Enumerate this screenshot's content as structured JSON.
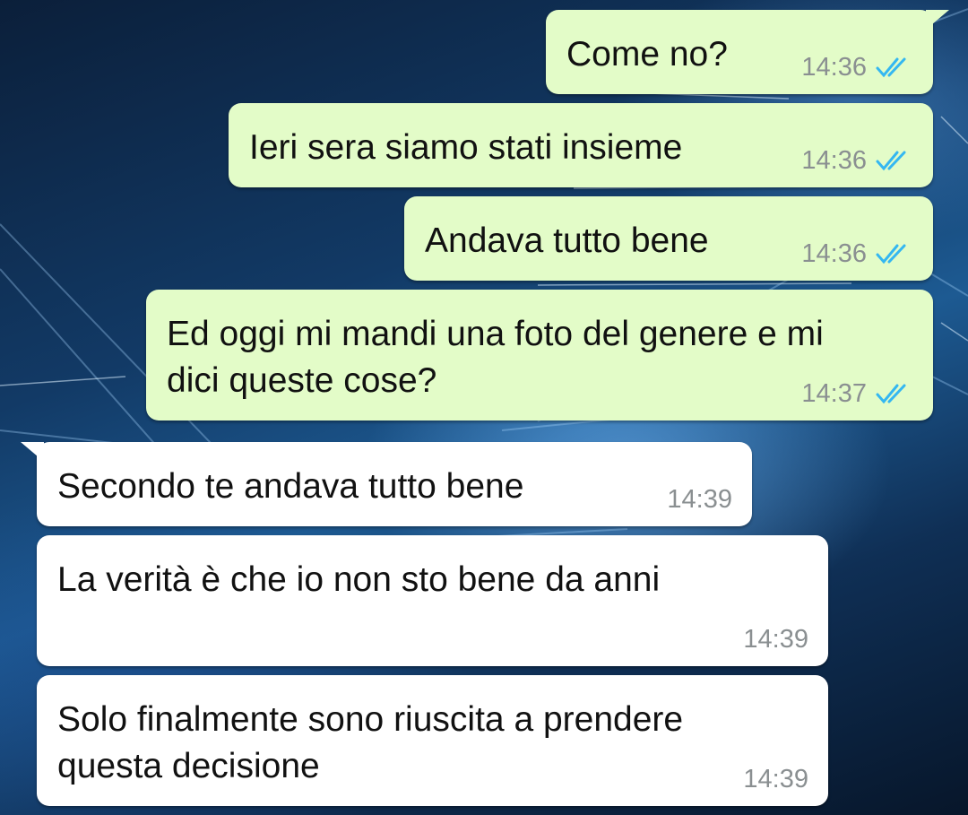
{
  "messages": [
    {
      "direction": "outgoing",
      "text": "Come no?",
      "time": "14:36",
      "status": "read-double-check-icon"
    },
    {
      "direction": "outgoing",
      "text": "Ieri sera siamo stati insieme",
      "time": "14:36",
      "status": "read-double-check-icon"
    },
    {
      "direction": "outgoing",
      "text": "Andava tutto bene",
      "time": "14:36",
      "status": "read-double-check-icon"
    },
    {
      "direction": "outgoing",
      "text": "Ed oggi mi mandi una foto del genere e mi\ndici queste cose?",
      "time": "14:37",
      "status": "read-double-check-icon"
    },
    {
      "direction": "incoming",
      "text": "Secondo te andava tutto bene",
      "time": "14:39"
    },
    {
      "direction": "incoming",
      "text": "La verità è che io non sto bene da anni",
      "time": "14:39"
    },
    {
      "direction": "incoming",
      "text": "Solo finalmente sono riuscita a prendere\nquesta decisione",
      "time": "14:39"
    }
  ],
  "colors": {
    "outgoing_bubble": "#e3fcc8",
    "incoming_bubble": "#ffffff",
    "read_tick": "#34b7f1",
    "timestamp": "#8a8f91"
  }
}
